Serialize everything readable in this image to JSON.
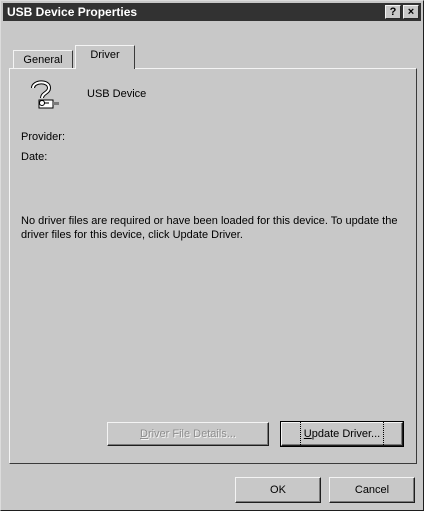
{
  "window": {
    "title": "USB Device Properties",
    "help_label": "?",
    "close_label": "×"
  },
  "tabs": [
    {
      "label": "General",
      "selected": false
    },
    {
      "label": "Driver",
      "selected": true
    }
  ],
  "device": {
    "icon": "unknown-device-icon",
    "name": "USB Device"
  },
  "labels": {
    "provider": "Provider:",
    "date": "Date:"
  },
  "message": "No driver files are required or have been loaded for this device.  To update the driver files for this device, click  Update Driver.",
  "buttons": {
    "driver_details": {
      "mnemonic": "D",
      "rest": "river File Details...",
      "enabled": false
    },
    "update_driver": {
      "mnemonic": "U",
      "rest": "pdate Driver...",
      "enabled": true
    },
    "ok": "OK",
    "cancel": "Cancel"
  }
}
